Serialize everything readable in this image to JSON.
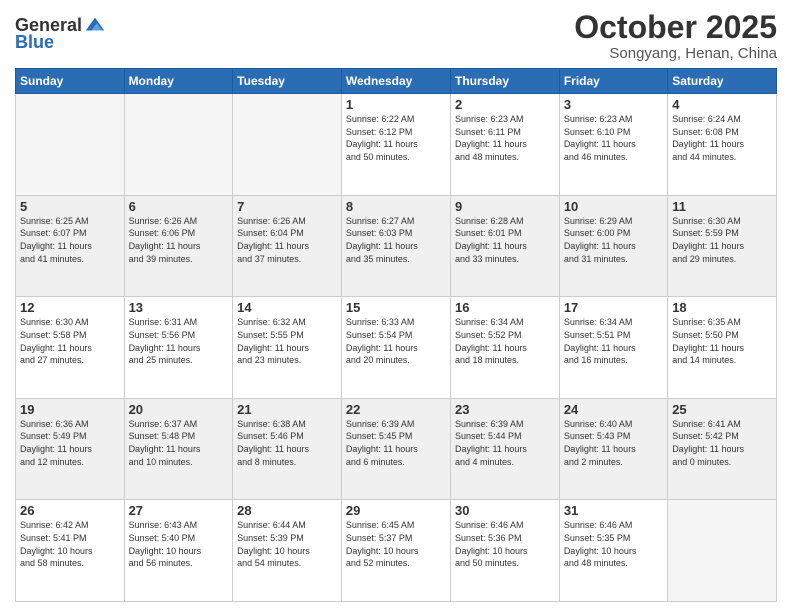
{
  "header": {
    "logo_general": "General",
    "logo_blue": "Blue",
    "month_title": "October 2025",
    "location": "Songyang, Henan, China"
  },
  "days_of_week": [
    "Sunday",
    "Monday",
    "Tuesday",
    "Wednesday",
    "Thursday",
    "Friday",
    "Saturday"
  ],
  "weeks": [
    [
      {
        "day": "",
        "info": ""
      },
      {
        "day": "",
        "info": ""
      },
      {
        "day": "",
        "info": ""
      },
      {
        "day": "1",
        "info": "Sunrise: 6:22 AM\nSunset: 6:12 PM\nDaylight: 11 hours\nand 50 minutes."
      },
      {
        "day": "2",
        "info": "Sunrise: 6:23 AM\nSunset: 6:11 PM\nDaylight: 11 hours\nand 48 minutes."
      },
      {
        "day": "3",
        "info": "Sunrise: 6:23 AM\nSunset: 6:10 PM\nDaylight: 11 hours\nand 46 minutes."
      },
      {
        "day": "4",
        "info": "Sunrise: 6:24 AM\nSunset: 6:08 PM\nDaylight: 11 hours\nand 44 minutes."
      }
    ],
    [
      {
        "day": "5",
        "info": "Sunrise: 6:25 AM\nSunset: 6:07 PM\nDaylight: 11 hours\nand 41 minutes."
      },
      {
        "day": "6",
        "info": "Sunrise: 6:26 AM\nSunset: 6:06 PM\nDaylight: 11 hours\nand 39 minutes."
      },
      {
        "day": "7",
        "info": "Sunrise: 6:26 AM\nSunset: 6:04 PM\nDaylight: 11 hours\nand 37 minutes."
      },
      {
        "day": "8",
        "info": "Sunrise: 6:27 AM\nSunset: 6:03 PM\nDaylight: 11 hours\nand 35 minutes."
      },
      {
        "day": "9",
        "info": "Sunrise: 6:28 AM\nSunset: 6:01 PM\nDaylight: 11 hours\nand 33 minutes."
      },
      {
        "day": "10",
        "info": "Sunrise: 6:29 AM\nSunset: 6:00 PM\nDaylight: 11 hours\nand 31 minutes."
      },
      {
        "day": "11",
        "info": "Sunrise: 6:30 AM\nSunset: 5:59 PM\nDaylight: 11 hours\nand 29 minutes."
      }
    ],
    [
      {
        "day": "12",
        "info": "Sunrise: 6:30 AM\nSunset: 5:58 PM\nDaylight: 11 hours\nand 27 minutes."
      },
      {
        "day": "13",
        "info": "Sunrise: 6:31 AM\nSunset: 5:56 PM\nDaylight: 11 hours\nand 25 minutes."
      },
      {
        "day": "14",
        "info": "Sunrise: 6:32 AM\nSunset: 5:55 PM\nDaylight: 11 hours\nand 23 minutes."
      },
      {
        "day": "15",
        "info": "Sunrise: 6:33 AM\nSunset: 5:54 PM\nDaylight: 11 hours\nand 20 minutes."
      },
      {
        "day": "16",
        "info": "Sunrise: 6:34 AM\nSunset: 5:52 PM\nDaylight: 11 hours\nand 18 minutes."
      },
      {
        "day": "17",
        "info": "Sunrise: 6:34 AM\nSunset: 5:51 PM\nDaylight: 11 hours\nand 16 minutes."
      },
      {
        "day": "18",
        "info": "Sunrise: 6:35 AM\nSunset: 5:50 PM\nDaylight: 11 hours\nand 14 minutes."
      }
    ],
    [
      {
        "day": "19",
        "info": "Sunrise: 6:36 AM\nSunset: 5:49 PM\nDaylight: 11 hours\nand 12 minutes."
      },
      {
        "day": "20",
        "info": "Sunrise: 6:37 AM\nSunset: 5:48 PM\nDaylight: 11 hours\nand 10 minutes."
      },
      {
        "day": "21",
        "info": "Sunrise: 6:38 AM\nSunset: 5:46 PM\nDaylight: 11 hours\nand 8 minutes."
      },
      {
        "day": "22",
        "info": "Sunrise: 6:39 AM\nSunset: 5:45 PM\nDaylight: 11 hours\nand 6 minutes."
      },
      {
        "day": "23",
        "info": "Sunrise: 6:39 AM\nSunset: 5:44 PM\nDaylight: 11 hours\nand 4 minutes."
      },
      {
        "day": "24",
        "info": "Sunrise: 6:40 AM\nSunset: 5:43 PM\nDaylight: 11 hours\nand 2 minutes."
      },
      {
        "day": "25",
        "info": "Sunrise: 6:41 AM\nSunset: 5:42 PM\nDaylight: 11 hours\nand 0 minutes."
      }
    ],
    [
      {
        "day": "26",
        "info": "Sunrise: 6:42 AM\nSunset: 5:41 PM\nDaylight: 10 hours\nand 58 minutes."
      },
      {
        "day": "27",
        "info": "Sunrise: 6:43 AM\nSunset: 5:40 PM\nDaylight: 10 hours\nand 56 minutes."
      },
      {
        "day": "28",
        "info": "Sunrise: 6:44 AM\nSunset: 5:39 PM\nDaylight: 10 hours\nand 54 minutes."
      },
      {
        "day": "29",
        "info": "Sunrise: 6:45 AM\nSunset: 5:37 PM\nDaylight: 10 hours\nand 52 minutes."
      },
      {
        "day": "30",
        "info": "Sunrise: 6:46 AM\nSunset: 5:36 PM\nDaylight: 10 hours\nand 50 minutes."
      },
      {
        "day": "31",
        "info": "Sunrise: 6:46 AM\nSunset: 5:35 PM\nDaylight: 10 hours\nand 48 minutes."
      },
      {
        "day": "",
        "info": ""
      }
    ]
  ]
}
